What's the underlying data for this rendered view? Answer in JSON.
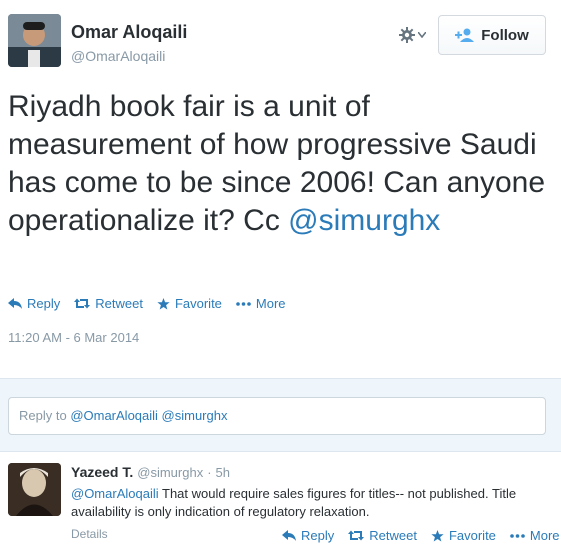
{
  "tweet": {
    "fullname": "Omar Aloqaili",
    "username": "@OmarAloqaili",
    "follow_label": "Follow",
    "text_before": "Riyadh book fair is a unit of measurement of how progressive Saudi has come to be since 2006! Can anyone operationalize it? Cc ",
    "mention": "@simurghx",
    "actions": {
      "reply": "Reply",
      "retweet": "Retweet",
      "favorite": "Favorite",
      "more": "More"
    },
    "timestamp": "11:20 AM - 6 Mar 2014"
  },
  "reply_box": {
    "prefix": "Reply to ",
    "mentions": "@OmarAloqaili @simurghx"
  },
  "reply_tweet": {
    "fullname": "Yazeed T.",
    "username": "@simurghx",
    "separator": "·",
    "time": "5h",
    "mention": "@OmarAloqaili",
    "text": " That would require sales figures for titles-- not published. Title availability is only indication of regulatory relaxation.",
    "details_label": "Details",
    "actions": {
      "reply": "Reply",
      "retweet": "Retweet",
      "favorite": "Favorite",
      "more": "More"
    }
  },
  "colors": {
    "link": "#2b7bb9",
    "muted": "#8899a6",
    "text": "#292f33",
    "reply_bg": "#eef5fb"
  }
}
